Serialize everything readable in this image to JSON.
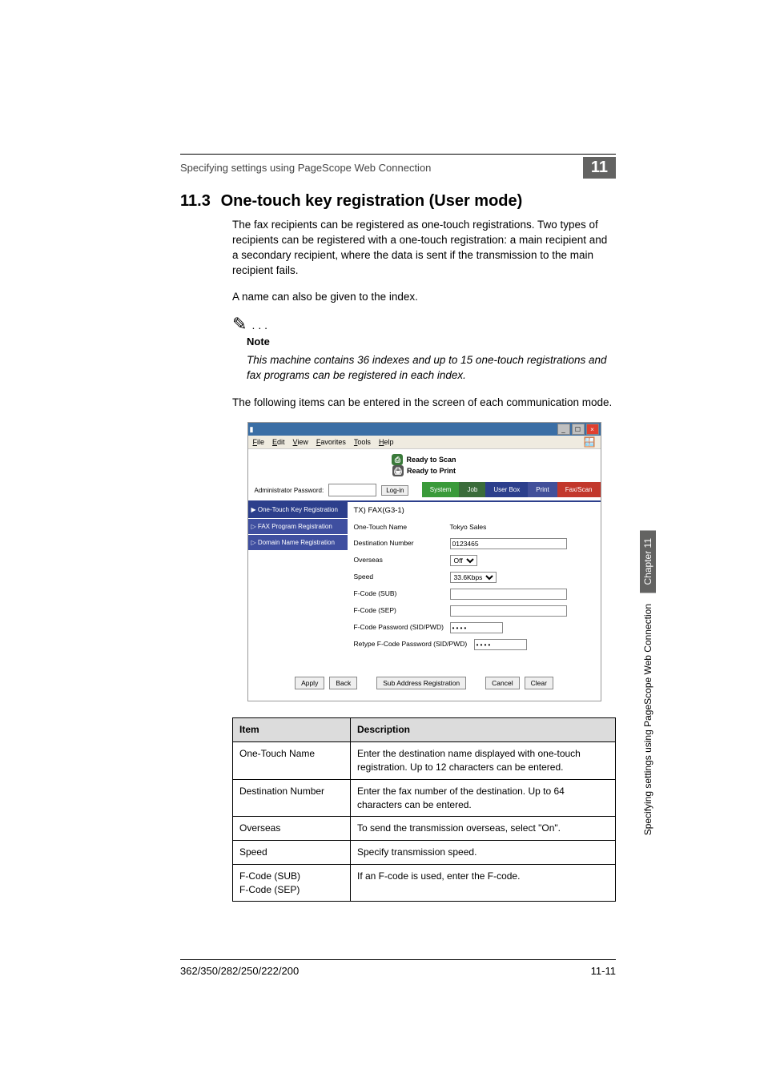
{
  "header": {
    "breadcrumb": "Specifying settings using PageScope Web Connection",
    "chapter_badge": "11"
  },
  "section": {
    "number": "11.3",
    "title": "One-touch key registration (User mode)"
  },
  "body": {
    "para1": "The fax recipients can be registered as one-touch registrations. Two types of recipients can be registered with a one-touch registration: a main recipient and a secondary recipient, where the data is sent if the transmission to the main recipient fails.",
    "para2": "A name can also be given to the index.",
    "note_label": "Note",
    "note_text": "This machine contains 36 indexes and up to 15 one-touch registrations and fax programs can be registered in each index.",
    "para3": "The following items can be entered in the screen of each communication mode."
  },
  "screenshot": {
    "menubar": [
      "File",
      "Edit",
      "View",
      "Favorites",
      "Tools",
      "Help"
    ],
    "ready1": "Ready to Scan",
    "ready2": "Ready to Print",
    "admin_label": "Administrator Password:",
    "login_btn": "Log-in",
    "tabs": {
      "system": "System",
      "job": "Job",
      "userbox": "User Box",
      "print": "Print",
      "faxscan": "Fax/Scan"
    },
    "sidebar": {
      "item1": "One-Touch Key Registration",
      "item2": "FAX Program Registration",
      "item3": "Domain Name Registration"
    },
    "form_title": "TX) FAX(G3-1)",
    "rows": {
      "one_touch_name_label": "One-Touch Name",
      "one_touch_name_value": "Tokyo Sales",
      "dest_number_label": "Destination Number",
      "dest_number_value": "0123465",
      "overseas_label": "Overseas",
      "overseas_value": "Off",
      "speed_label": "Speed",
      "speed_value": "33.6Kbps",
      "fcode_sub_label": "F-Code (SUB)",
      "fcode_sub_value": "",
      "fcode_sep_label": "F-Code (SEP)",
      "fcode_sep_value": "",
      "fcode_pwd_label": "F-Code Password (SID/PWD)",
      "fcode_repwd_label": "Retype F-Code Password (SID/PWD)"
    },
    "buttons": {
      "apply": "Apply",
      "back": "Back",
      "sub": "Sub Address Registration",
      "cancel": "Cancel",
      "clear": "Clear"
    }
  },
  "table": {
    "head_item": "Item",
    "head_desc": "Description",
    "rows": [
      {
        "item": "One-Touch Name",
        "desc": "Enter the destination name displayed with one-touch registration. Up to 12 characters can be entered."
      },
      {
        "item": "Destination Number",
        "desc": "Enter the fax number of the destination. Up to 64 characters can be entered."
      },
      {
        "item": "Overseas",
        "desc": "To send the transmission overseas, select \"On\"."
      },
      {
        "item": "Speed",
        "desc": "Specify transmission speed."
      },
      {
        "item": "F-Code (SUB)\nF-Code (SEP)",
        "desc": "If an F-code is used, enter the F-code."
      }
    ]
  },
  "sidetabs": {
    "dark": "Chapter 11",
    "light": "Specifying settings using PageScope Web Connection"
  },
  "footer": {
    "left": "362/350/282/250/222/200",
    "right": "11-11"
  }
}
